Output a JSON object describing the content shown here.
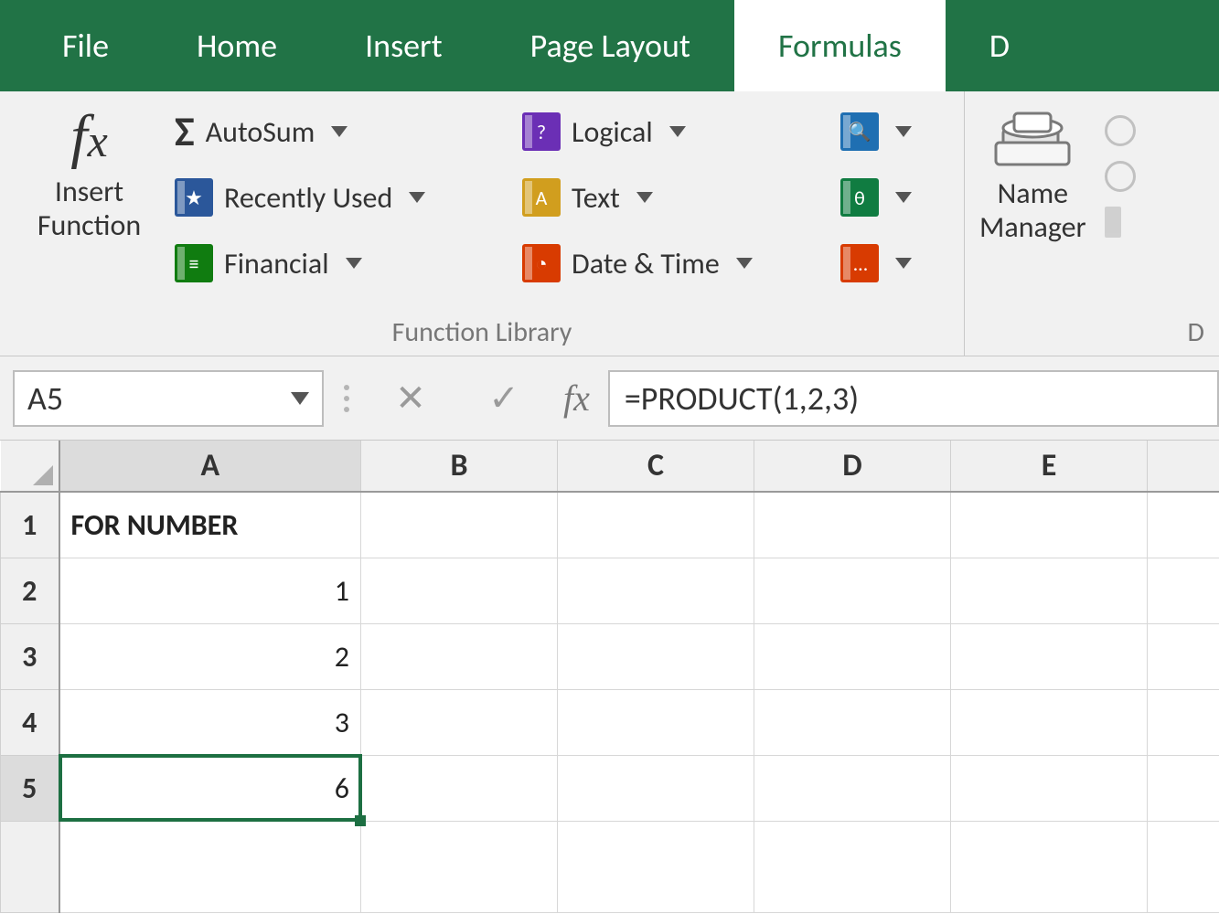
{
  "menu": {
    "tabs": [
      "File",
      "Home",
      "Insert",
      "Page Layout",
      "Formulas",
      "D"
    ],
    "active_index": 4
  },
  "ribbon": {
    "insert_function": "Insert\nFunction",
    "group1_label": "Function Library",
    "autosum": "AutoSum",
    "recently_used": "Recently Used",
    "financial": "Financial",
    "logical": "Logical",
    "text": "Text",
    "date_time": "Date & Time",
    "name_manager": "Name\nManager",
    "group2_label": "D"
  },
  "namebox": {
    "value": "A5"
  },
  "formula_bar": {
    "fx": "fx",
    "value": "=PRODUCT(1,2,3)"
  },
  "grid": {
    "columns": [
      "A",
      "B",
      "C",
      "D",
      "E"
    ],
    "rows": [
      "1",
      "2",
      "3",
      "4",
      "5"
    ],
    "selected": "A5",
    "cells": {
      "A1": "FOR NUMBER",
      "A2": "1",
      "A3": "2",
      "A4": "3",
      "A5": "6"
    }
  }
}
